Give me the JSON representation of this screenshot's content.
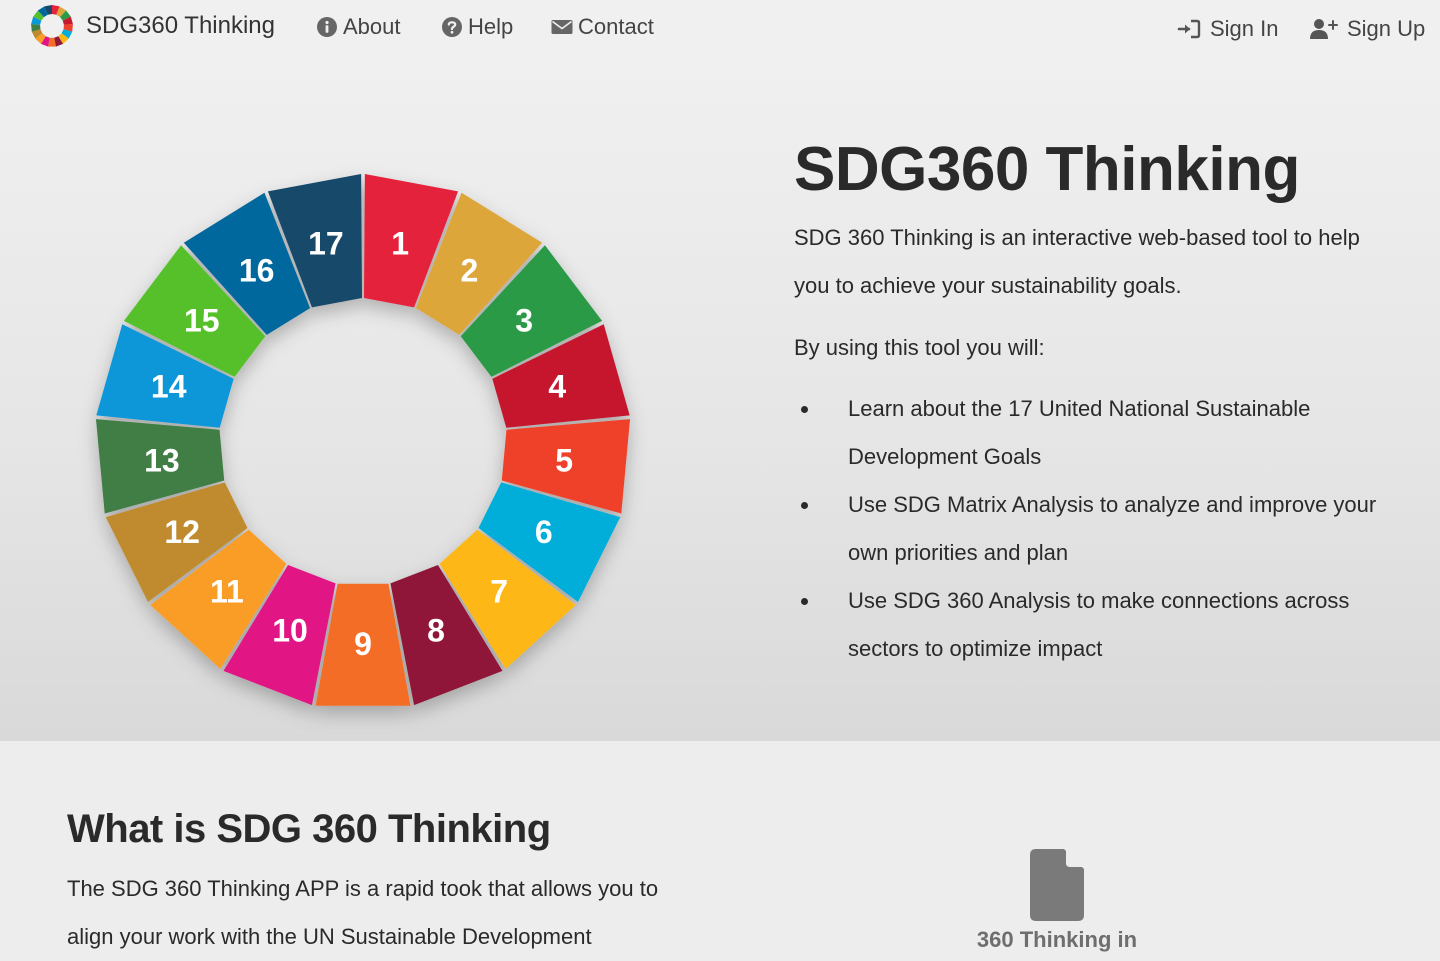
{
  "nav": {
    "brand": "SDG360 Thinking",
    "about": "About",
    "help": "Help",
    "contact": "Contact",
    "sign_in": "Sign In",
    "sign_up": "Sign Up"
  },
  "hero": {
    "title": "SDG360 Thinking",
    "intro": "SDG 360 Thinking is an interactive web-based tool to help you to achieve your sustainability goals.",
    "lead": "By using this tool you will:",
    "benefits": [
      "Learn about the 17 United National Sustainable Development Goals",
      "Use SDG Matrix Analysis to analyze and improve your own priorities and plan",
      "Use SDG 360 Analysis to make connections across sectors to optimize impact"
    ]
  },
  "sdg_wheel": {
    "segments": [
      {
        "label": "1",
        "color": "#e5243b"
      },
      {
        "label": "2",
        "color": "#dda63a"
      },
      {
        "label": "3",
        "color": "#2b9a46"
      },
      {
        "label": "4",
        "color": "#c5192d"
      },
      {
        "label": "5",
        "color": "#ef402b"
      },
      {
        "label": "6",
        "color": "#00aed9"
      },
      {
        "label": "7",
        "color": "#fdb713"
      },
      {
        "label": "8",
        "color": "#8f1838"
      },
      {
        "label": "9",
        "color": "#f36d25"
      },
      {
        "label": "10",
        "color": "#e11484"
      },
      {
        "label": "11",
        "color": "#f99d26"
      },
      {
        "label": "12",
        "color": "#bf8b2e"
      },
      {
        "label": "13",
        "color": "#3f7e44"
      },
      {
        "label": "14",
        "color": "#0a97d9"
      },
      {
        "label": "15",
        "color": "#56c02b"
      },
      {
        "label": "16",
        "color": "#00689d"
      },
      {
        "label": "17",
        "color": "#19486a"
      }
    ]
  },
  "what_is": {
    "title": "What is SDG 360 Thinking",
    "body": "The SDG 360 Thinking APP is a rapid took that allows you to align your work with the UN Sustainable Development",
    "doc_label": "360 Thinking in"
  },
  "icons": {
    "brand": "sdg-wheel-logo-icon",
    "about": "info-circle-icon",
    "help": "question-circle-icon",
    "contact": "envelope-icon",
    "sign_in": "sign-in-icon",
    "sign_up": "user-plus-icon",
    "document": "file-icon"
  }
}
